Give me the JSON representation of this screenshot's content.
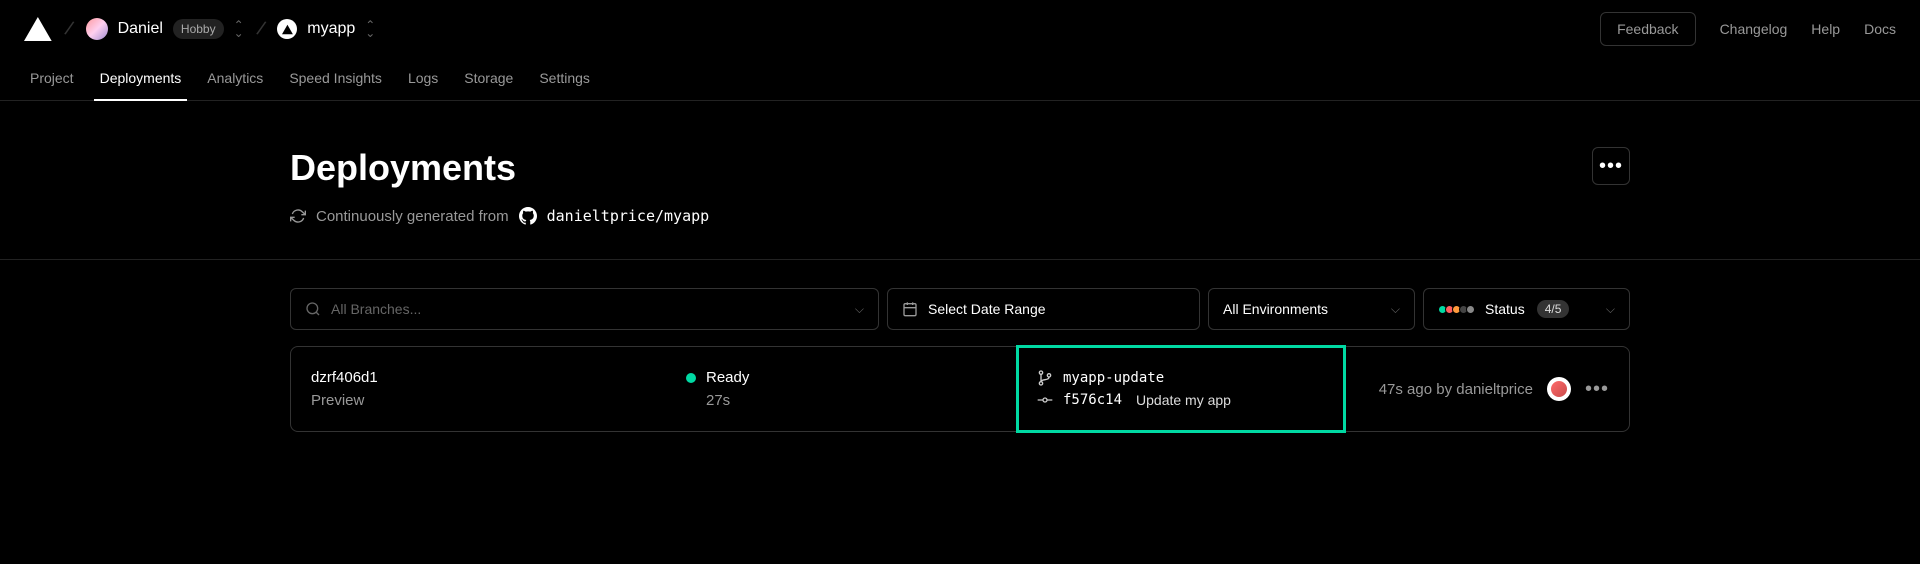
{
  "topbar": {
    "user_name": "Daniel",
    "plan_badge": "Hobby",
    "project_name": "myapp",
    "feedback": "Feedback",
    "links": [
      "Changelog",
      "Help",
      "Docs"
    ]
  },
  "nav": {
    "tabs": [
      "Project",
      "Deployments",
      "Analytics",
      "Speed Insights",
      "Logs",
      "Storage",
      "Settings"
    ],
    "active_index": 1
  },
  "page": {
    "title": "Deployments",
    "subtitle_prefix": "Continuously generated from",
    "repo": "danieltprice/myapp"
  },
  "filters": {
    "branches_placeholder": "All Branches...",
    "date_label": "Select Date Range",
    "env_label": "All Environments",
    "status_label": "Status",
    "status_count": "4/5",
    "status_colors": [
      "#00d9a3",
      "#ff5e5e",
      "#ff9a3c",
      "#444",
      "#888"
    ]
  },
  "deployment": {
    "id": "dzrf406d1",
    "environment": "Preview",
    "status_label": "Ready",
    "duration": "27s",
    "branch": "myapp-update",
    "commit_sha": "f576c14",
    "commit_message": "Update my app",
    "time_ago": "47s ago by danieltprice"
  }
}
